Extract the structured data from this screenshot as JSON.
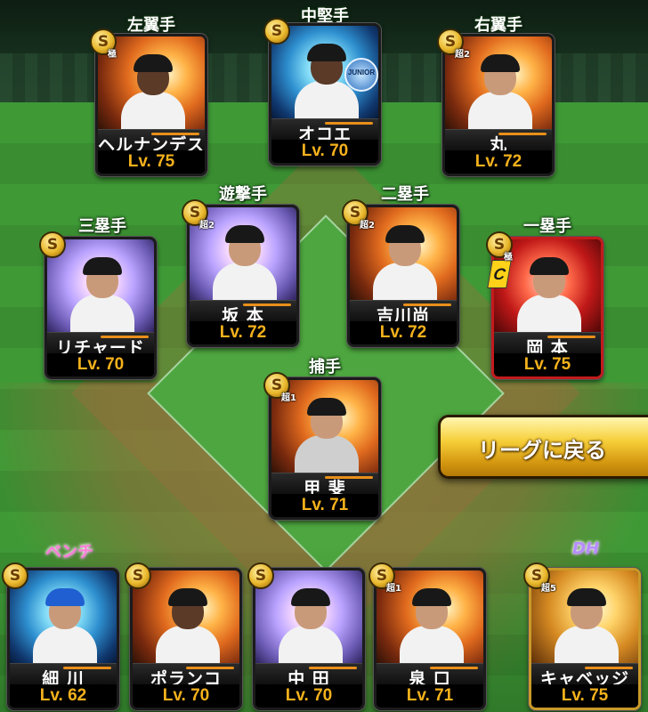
{
  "button": {
    "return_label": "リーグに戻る"
  },
  "positions": {
    "lf": "左翼手",
    "cf": "中堅手",
    "rf": "右翼手",
    "ss": "遊撃手",
    "b2": "二塁手",
    "b3": "三塁手",
    "b1": "一塁手",
    "c": "捕手",
    "bench": "ベンチ",
    "dh": "DH"
  },
  "players": [
    {
      "id": "lf",
      "name": "ヘルナンデス",
      "level": "Lv. 75",
      "badge": "S",
      "sub": "極",
      "theme": "fire"
    },
    {
      "id": "cf",
      "name": "オコエ",
      "level": "Lv. 70",
      "badge": "S",
      "sub": "",
      "theme": "ice",
      "logo": "JUNIOR"
    },
    {
      "id": "rf",
      "name": "丸",
      "level": "Lv. 72",
      "badge": "S",
      "sub": "超2",
      "theme": "fire"
    },
    {
      "id": "ss",
      "name": "坂 本",
      "level": "Lv. 72",
      "badge": "S",
      "sub": "超2",
      "theme": "prism"
    },
    {
      "id": "b2",
      "name": "吉川尚",
      "level": "Lv. 72",
      "badge": "S",
      "sub": "超2",
      "theme": "fire"
    },
    {
      "id": "b3",
      "name": "リチャード",
      "level": "Lv. 70",
      "badge": "S",
      "sub": "",
      "theme": "prism"
    },
    {
      "id": "b1",
      "name": "岡 本",
      "level": "Lv. 75",
      "badge": "S",
      "sub": "極",
      "theme": "crim",
      "special": "C"
    },
    {
      "id": "c",
      "name": "甲 斐",
      "level": "Lv. 71",
      "badge": "S",
      "sub": "超1",
      "theme": "fire"
    },
    {
      "id": "bn1",
      "name": "細 川",
      "level": "Lv. 62",
      "badge": "S",
      "sub": "",
      "theme": "ice"
    },
    {
      "id": "bn2",
      "name": "ポランコ",
      "level": "Lv. 70",
      "badge": "S",
      "sub": "",
      "theme": "fire"
    },
    {
      "id": "bn3",
      "name": "中 田",
      "level": "Lv. 70",
      "badge": "S",
      "sub": "",
      "theme": "prism"
    },
    {
      "id": "bn4",
      "name": "泉 口",
      "level": "Lv. 71",
      "badge": "S",
      "sub": "超1",
      "theme": "fire"
    },
    {
      "id": "dh",
      "name": "キャベッジ",
      "level": "Lv. 75",
      "badge": "S",
      "sub": "超5",
      "theme": "gold2"
    }
  ]
}
